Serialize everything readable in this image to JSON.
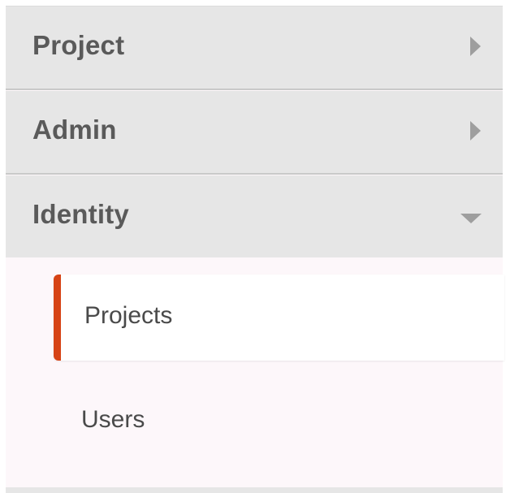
{
  "nav": {
    "sections": [
      {
        "label": "Project",
        "state": "collapsed",
        "icon": "chevron-right-icon"
      },
      {
        "label": "Admin",
        "state": "collapsed",
        "icon": "chevron-right-icon"
      },
      {
        "label": "Identity",
        "state": "expanded",
        "icon": "chevron-down-icon"
      }
    ],
    "identity_items": [
      {
        "label": "Projects",
        "active": true
      },
      {
        "label": "Users",
        "active": false
      }
    ]
  },
  "colors": {
    "section_bg": "#e6e6e6",
    "subpanel_bg": "#fdf7fa",
    "active_accent": "#d64315",
    "text": "#5a5a5a",
    "chevron": "#9e9e9e"
  }
}
